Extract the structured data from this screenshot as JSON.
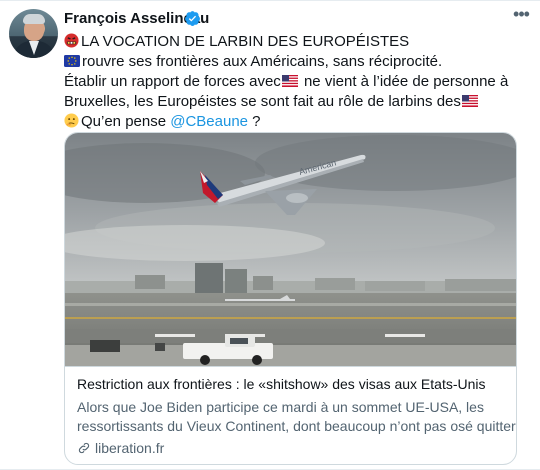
{
  "tweet": {
    "author": {
      "display_name": "François Asselineau",
      "verified": true
    },
    "more_label": "•••",
    "lines": {
      "line1": "LA VOCATION DE LARBIN DES EUROPÉISTES",
      "line2": "rouvre ses frontières aux Américains, sans réciprocité.",
      "line3": "Établir un rapport de forces avec",
      "line3_tail": " ne vient à l’idée de personne à",
      "line4": "Bruxelles, les Européistes se sont fait au rôle de larbins des",
      "line5_prefix": "Qu’en pense ",
      "line5_mention": "@CBeaune",
      "line5_suffix": " ?"
    },
    "emojis": {
      "line1": "angry-face-symbols",
      "line2": "eu-flag",
      "line3": "us-flag",
      "line4": "us-flag",
      "line5": "thinking-face"
    }
  },
  "card": {
    "image_alt": "American Airlines plane taking off",
    "plane_livery": "American",
    "title": "Restriction aux frontières : le «shitshow» des visas aux Etats-Unis",
    "description_line1": "Alors que Joe Biden participe ce mardi à un sommet UE-USA, les",
    "description_line2": "ressortissants du Vieux Continent, dont beaucoup n’ont pas osé quitter …",
    "domain": "liberation.fr"
  },
  "colors": {
    "link": "#1b95e0",
    "secondary_text": "#536471",
    "verified": "#1d9bf0",
    "border": "#cfd9de"
  }
}
